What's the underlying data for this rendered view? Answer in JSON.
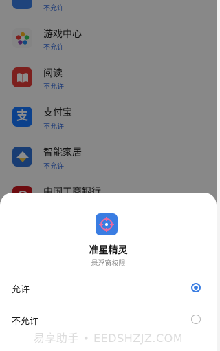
{
  "apps": [
    {
      "name": "",
      "status": "不允许",
      "icon": "blue-app-icon",
      "color": "#3a7de2"
    },
    {
      "name": "游戏中心",
      "status": "不允许",
      "icon": "game-center-star-icon",
      "color": "#f0f0f0"
    },
    {
      "name": "阅读",
      "status": "不允许",
      "icon": "reader-book-icon",
      "color": "#e23b37"
    },
    {
      "name": "支付宝",
      "status": "不允许",
      "icon": "alipay-icon",
      "color": "#1677ff"
    },
    {
      "name": "智能家居",
      "status": "不允许",
      "icon": "smart-home-icon",
      "color": "#2e6fd1"
    },
    {
      "name": "中国工商银行",
      "status": "",
      "icon": "icbc-icon",
      "color": "#c7161e"
    }
  ],
  "dialog": {
    "app_name": "准星精灵",
    "subtitle": "悬浮窗权限",
    "app_icon": "crosshair-icon",
    "options": [
      {
        "label": "允许",
        "selected": true
      },
      {
        "label": "不允许",
        "selected": false
      }
    ]
  },
  "watermark": "易享助手 • EEDSHZJZ.COM",
  "accent_color": "#3a7de2"
}
